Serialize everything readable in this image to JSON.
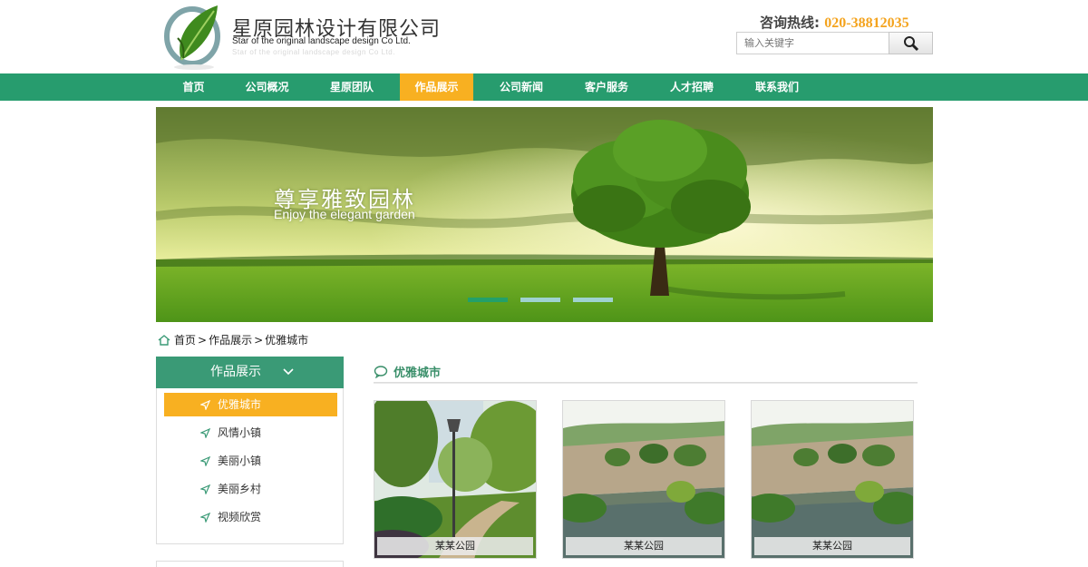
{
  "header": {
    "company_cn": "星原园林设计有限公司",
    "company_en": "Star of the original landscape design Co Ltd.",
    "hotline_label": "咨询热线:",
    "hotline_number": "020-38812035",
    "search_placeholder": "输入关键字"
  },
  "nav": {
    "items": [
      {
        "label": "首页"
      },
      {
        "label": "公司概况"
      },
      {
        "label": "星原团队"
      },
      {
        "label": "作品展示",
        "active": true
      },
      {
        "label": "公司新闻"
      },
      {
        "label": "客户服务"
      },
      {
        "label": "人才招聘"
      },
      {
        "label": "联系我们"
      }
    ]
  },
  "banner": {
    "title_cn": "尊享雅致园林",
    "title_en": "Enjoy the elegant garden",
    "active_slide": 1,
    "slide_count": 3
  },
  "breadcrumb": {
    "home": "首页",
    "sep": ">",
    "section": "作品展示",
    "current": "优雅城市"
  },
  "sidebar": {
    "title": "作品展示",
    "items": [
      {
        "label": "优雅城市",
        "active": true
      },
      {
        "label": "风情小镇"
      },
      {
        "label": "美丽小镇"
      },
      {
        "label": "美丽乡村"
      },
      {
        "label": "视频欣赏"
      }
    ]
  },
  "content": {
    "section_title": "优雅城市",
    "projects": [
      {
        "caption": "某某公园",
        "image": "park-path-lamp"
      },
      {
        "caption": "某某公园",
        "image": "park-pond"
      },
      {
        "caption": "某某公园",
        "image": "park-pond"
      }
    ]
  },
  "colors": {
    "nav_green": "#279c6e",
    "accent_orange": "#f8b021",
    "sidebar_green": "#3a9a76",
    "title_green": "#3a8f6a"
  }
}
